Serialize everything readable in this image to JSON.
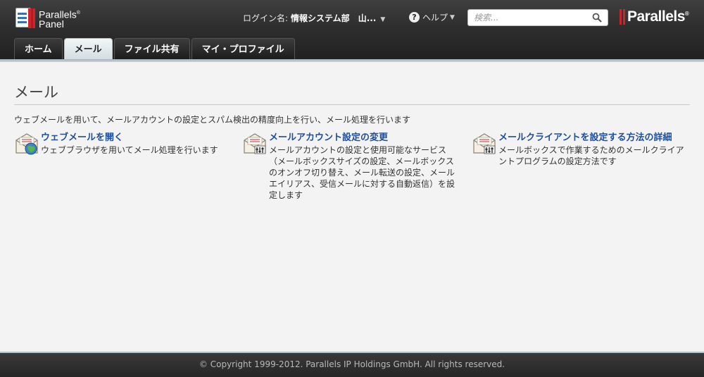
{
  "header": {
    "logo_line1": "Parallels",
    "logo_line2": "Panel",
    "login_label": "ログイン名:",
    "login_value": "情報システム部　山...",
    "help_label": "ヘルプ",
    "search_placeholder": "検索...",
    "brand": "Parallels"
  },
  "tabs": [
    {
      "label": "ホーム",
      "active": false
    },
    {
      "label": "メール",
      "active": true
    },
    {
      "label": "ファイル共有",
      "active": false
    },
    {
      "label": "マイ・プロファイル",
      "active": false
    }
  ],
  "main": {
    "title": "メール",
    "description": "ウェブメールを用いて、メールアカウントの設定とスパム検出の精度向上を行い、メール処理を行います",
    "tools": [
      {
        "title": "ウェブメールを開く",
        "description": "ウェブブラウザを用いてメール処理を行います",
        "icon": "webmail-icon"
      },
      {
        "title": "メールアカウント設定の変更",
        "description": "メールアカウントの設定と使用可能なサービス（メールボックスサイズの設定、メールボックスのオンオフ切り替え、メール転送の設定、メールエイリアス、受信メールに対する自動返信）を設定します",
        "icon": "mail-settings-icon"
      },
      {
        "title": "メールクライアントを設定する方法の詳細",
        "description": "メールボックスで作業するためのメールクライアントプログラムの設定方法です",
        "icon": "mail-client-settings-icon"
      }
    ]
  },
  "footer": {
    "copyright": "© Copyright 1999-2012. Parallels IP Holdings GmbH. All rights reserved."
  },
  "colors": {
    "accent_red": "#c8262c",
    "link_blue": "#1f4e9a",
    "header_dark": "#2a2a2a"
  }
}
